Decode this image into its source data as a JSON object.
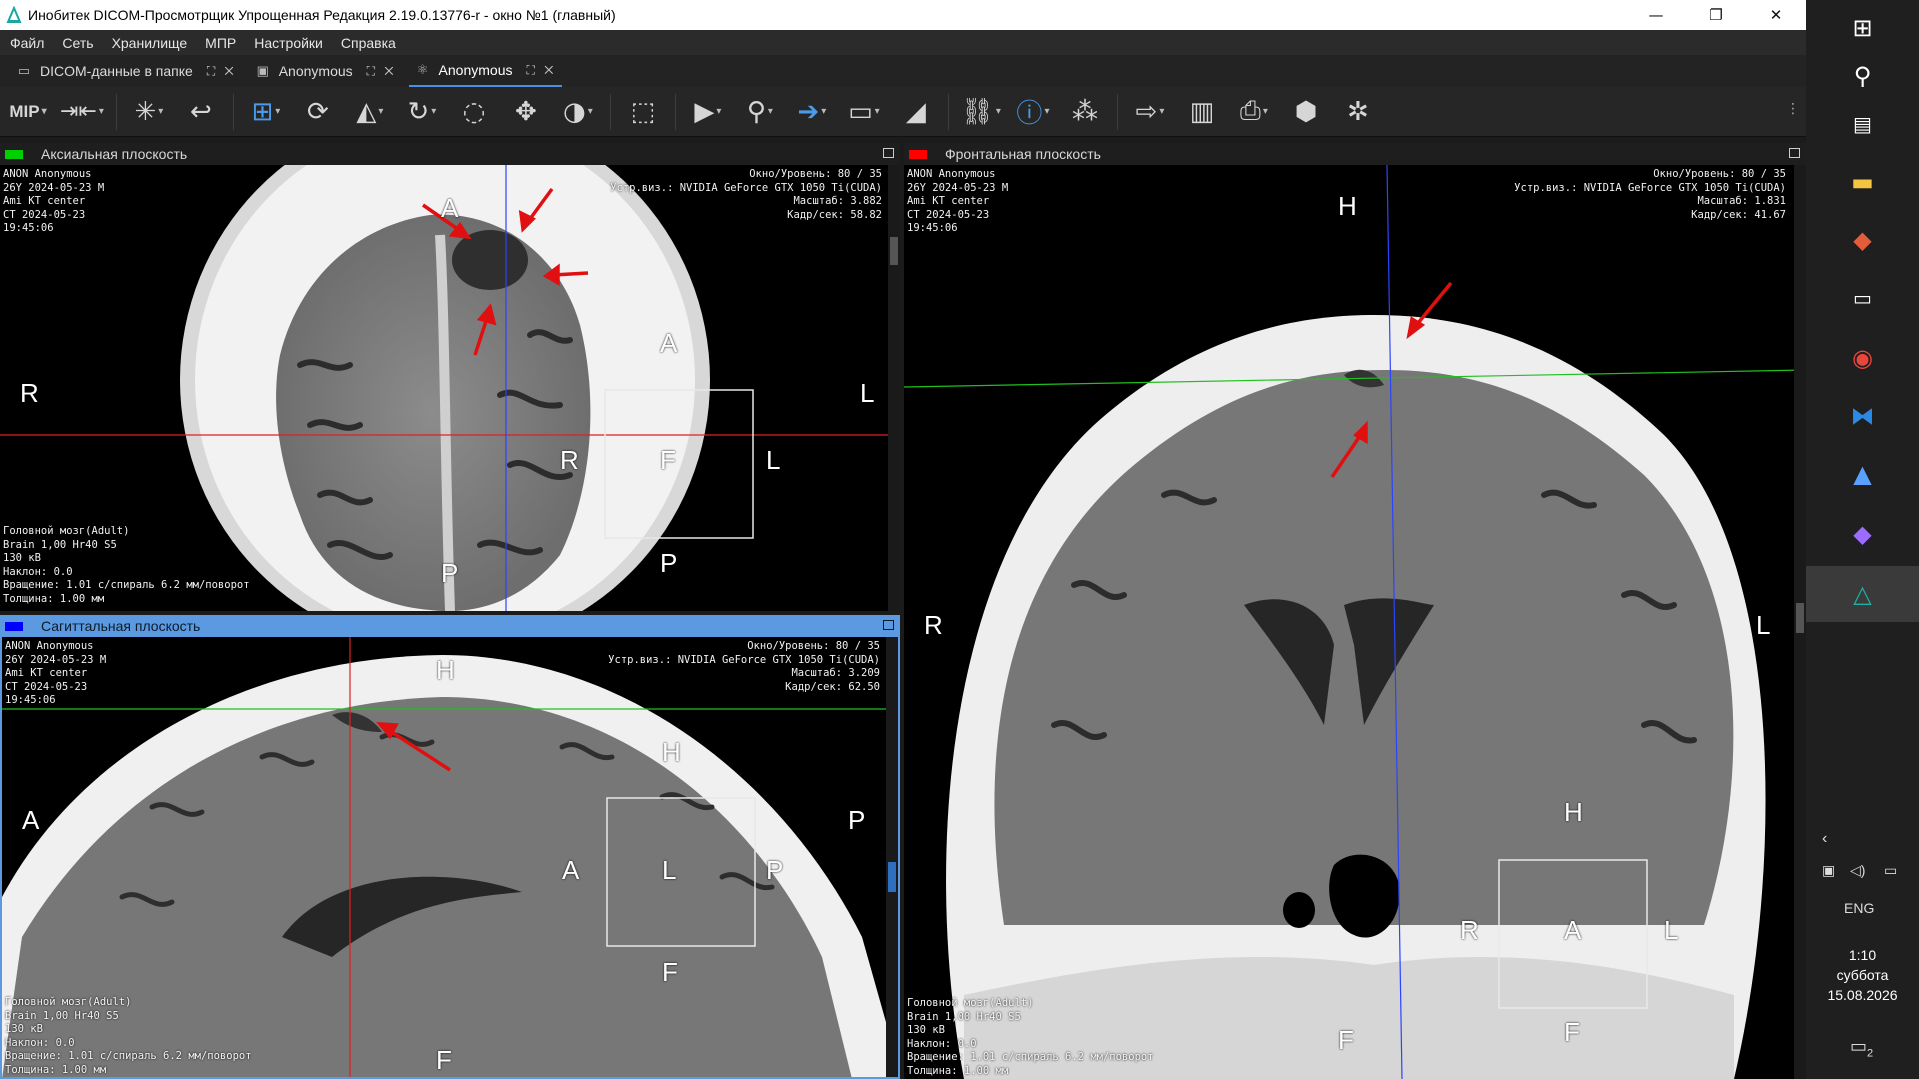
{
  "window": {
    "title": "Инобитек DICOM-Просмотрщик Упрощенная Редакция 2.19.0.13776-r - окно №1 (главный)",
    "minimize": "—",
    "restore": "❐",
    "close": "✕"
  },
  "menu": [
    "Файл",
    "Сеть",
    "Хранилище",
    "МПР",
    "Настройки",
    "Справка"
  ],
  "tabs": [
    {
      "label": "DICOM-данные в папке",
      "icon": "folder-icon",
      "ctrl": "⛶ ✕"
    },
    {
      "label": "Anonymous",
      "icon": "study-icon",
      "ctrl": "⛶ ✕"
    },
    {
      "label": "Anonymous",
      "icon": "mpr-icon",
      "ctrl": "⛶ ✕",
      "active": true
    }
  ],
  "toolbar": {
    "mip_label": "MIP"
  },
  "viewports": {
    "axial": {
      "title": "Аксиальная плоскость",
      "color": "#00d000",
      "top_left": "ANON Anonymous\n26Y 2024-05-23 M\nAmi KT center\nCT 2024-05-23\n19:45:06",
      "top_right": "Окно/Уровень: 80 / 35\nУстр.виз.: NVIDIA GeForce GTX 1050 Ti(CUDA)\nМасштаб: 3.882\nКадр/сек: 58.82",
      "bottom_left": "Головной мозг(Adult)\nBrain 1,00 Hr40 S5\n130 кВ\nНаклон: 0.0\nВращение: 1.01 с/спираль 6.2 мм/поворот\nТолщина: 1.00 мм",
      "orient": {
        "top": "A",
        "bottom": "P",
        "left": "R",
        "right": "L"
      },
      "cube": {
        "center": "F",
        "left": "R",
        "right": "L",
        "top": "A",
        "bottom": "P"
      }
    },
    "sagittal": {
      "title": "Сагиттальная плоскость",
      "color": "#0000ff",
      "top_left": "ANON Anonymous\n26Y 2024-05-23 M\nAmi KT center\nCT 2024-05-23\n19:45:06",
      "top_right": "Окно/Уровень: 80 / 35\nУстр.виз.: NVIDIA GeForce GTX 1050 Ti(CUDA)\nМасштаб: 3.209\nКадр/сек: 62.50",
      "bottom_left": "Головной мозг(Adult)\nBrain 1,00 Hr40 S5\n130 кВ\nНаклон: 0.0\nВращение: 1.01 с/спираль 6.2 мм/поворот\nТолщина: 1.00 мм",
      "orient": {
        "top": "H",
        "bottom": "F",
        "left": "A",
        "right": "P"
      },
      "cube": {
        "center": "L",
        "left": "A",
        "right": "P",
        "top": "H",
        "bottom": "F"
      }
    },
    "coronal": {
      "title": "Фронтальная плоскость",
      "color": "#ff0000",
      "top_left": "ANON Anonymous\n26Y 2024-05-23 M\nAmi KT center\nCT 2024-05-23\n19:45:06",
      "top_right": "Окно/Уровень: 80 / 35\nУстр.виз.: NVIDIA GeForce GTX 1050 Ti(CUDA)\nМасштаб: 1.831\nКадр/сек: 41.67",
      "bottom_left": "Головной мозг(Adult)\nBrain 1,00 Hr40 S5\n130 кВ\nНаклон: 0.0\nВращение: 1.01 с/спираль 6.2 мм/поворот\nТолщина: 1.00 мм",
      "orient": {
        "top": "H",
        "bottom": "F",
        "left": "R",
        "right": "L"
      },
      "cube": {
        "center": "A",
        "left": "R",
        "right": "L",
        "top": "H",
        "bottom": "F"
      }
    }
  },
  "taskbar": {
    "language": "ENG",
    "time": "1:10",
    "day": "суббота",
    "date": "15.08.2026",
    "notifications": "2"
  }
}
